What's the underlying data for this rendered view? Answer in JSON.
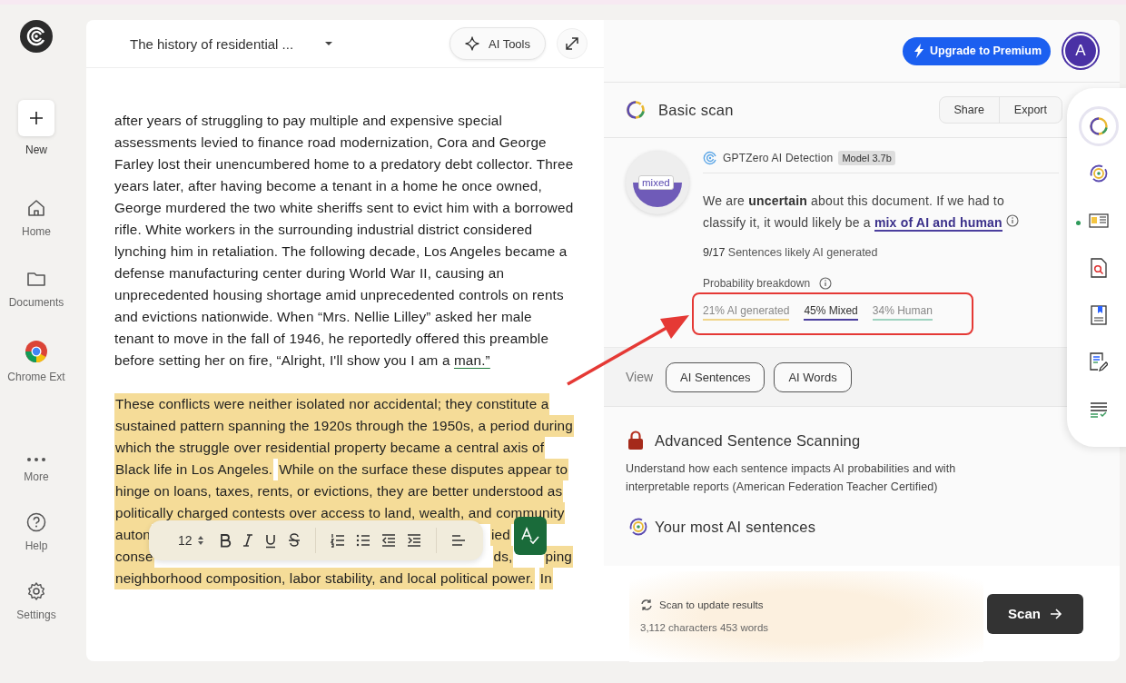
{
  "sidebar": {
    "top": [
      {
        "label": "New",
        "kind": "new"
      }
    ],
    "main": [
      {
        "label": "Home",
        "kind": "home"
      },
      {
        "label": "Documents",
        "kind": "folder"
      },
      {
        "label": "Chrome Ext",
        "kind": "chrome"
      }
    ],
    "bottom": [
      {
        "label": "More",
        "kind": "more"
      },
      {
        "label": "Help",
        "kind": "help"
      },
      {
        "label": "Settings",
        "kind": "settings"
      }
    ]
  },
  "editor": {
    "doc_title": "The history of residential ...",
    "ai_tools": "AI Tools",
    "paragraph_1": {
      "text": "after years of struggling to pay multiple and expensive special assessments levied to finance road modernization, Cora and George Farley lost their unencumbered home to a predatory debt collector. Three years later, after having become a tenant in a home he once owned, George murdered the two white sheriffs sent to evict him with a borrowed rifle. White workers in the surrounding industrial district considered lynching him in retaliation. The following decade, Los Angeles became a defense manufacturing center during World War II, causing an unprecedented housing shortage amid unprecedented controls on rents and evictions nationwide. When “Mrs. Nellie Lilley” asked her male tenant to move in the fall of 1946, he reportedly offered this preamble before setting her on fire, “Alright, I'll show you I am a",
      "flagged_word": "man.”"
    },
    "paragraph_2_lines": [
      {
        "kind": "full",
        "segments": [
          {
            "text": "These conflicts were neither isolated nor accidental; they constitute a",
            "highlighted": true
          }
        ]
      },
      {
        "kind": "full",
        "segments": [
          {
            "text": "sustained pattern spanning the 1920s through the 1950s, a period during",
            "highlighted": true
          }
        ]
      },
      {
        "kind": "full",
        "segments": [
          {
            "text": "which the struggle over residential property became a central axis of",
            "highlighted": true
          }
        ]
      },
      {
        "kind": "full",
        "segments": [
          {
            "text": "Black life in Los Angeles.",
            "highlighted": true
          },
          {
            "text": "While on the surface these disputes appear to",
            "highlighted": true
          }
        ]
      },
      {
        "kind": "full",
        "segments": [
          {
            "text": "hinge on loans, taxes, rents, or evictions, they are better understood as",
            "highlighted": true
          }
        ]
      },
      {
        "kind": "full",
        "segments": [
          {
            "text": "politically charged contests over access to land, wealth, and community",
            "highlighted": true
          }
        ]
      },
      {
        "kind": "covered",
        "segments": [
          {
            "text": "auton",
            "highlighted": true
          },
          {
            "text": "ied",
            "highlighted": true
          }
        ]
      },
      {
        "kind": "covered",
        "segments": [
          {
            "text": "conse",
            "highlighted": true
          },
          {
            "text": "ds,",
            "highlighted": true
          },
          {
            "text": "ping",
            "highlighted": true
          }
        ]
      },
      {
        "kind": "full",
        "segments": [
          {
            "text": "neighborhood composition, labor stability, and local political power.",
            "highlighted": true
          },
          {
            "text": "In",
            "highlighted": true
          }
        ]
      }
    ]
  },
  "format_toolbar": {
    "font_size": "12"
  },
  "header": {
    "upgrade": "Upgrade to Premium",
    "avatar": "A"
  },
  "scan": {
    "title": "Basic scan",
    "share": "Share",
    "export": "Export"
  },
  "result": {
    "gauge_label": "mixed",
    "detector": "GPTZero AI Detection",
    "model": "Model 3.7b",
    "verdict": "We are **uncertain** about this document. If we had to classify it, it would likely be a",
    "verdict_link": "mix of AI and human",
    "count": "9/17",
    "count_label": "Sentences likely AI generated",
    "breakdown_label": "Probability breakdown",
    "breakdown": [
      {
        "label": "21% AI generated",
        "color": "#f0d58a",
        "selected": false
      },
      {
        "label": "45% Mixed",
        "color": "#4b3f9e",
        "selected": true
      },
      {
        "label": "34% Human",
        "color": "#9fd3c0",
        "selected": false
      }
    ]
  },
  "view": {
    "label": "View",
    "buttons": [
      "AI Sentences",
      "AI Words"
    ]
  },
  "advanced": {
    "title": "Advanced Sentence Scanning",
    "text": "Understand how each sentence impacts AI probabilities and with interpretable reports (American Federation Teacher Certified)",
    "most_title": "Your most AI sentences"
  },
  "footer": {
    "status": "Scan to update results",
    "counts": "3,112 characters 453 words",
    "scan_button": "Scan"
  },
  "tools": [
    {
      "kind": "scan",
      "selected": true,
      "badge": false
    },
    {
      "kind": "target",
      "selected": false,
      "badge": false
    },
    {
      "kind": "card",
      "selected": false,
      "badge": true
    },
    {
      "kind": "search-doc",
      "selected": false,
      "badge": false
    },
    {
      "kind": "bookmark-doc",
      "selected": false,
      "badge": false
    },
    {
      "kind": "edit-doc",
      "selected": false,
      "badge": false
    },
    {
      "kind": "list-check",
      "selected": false,
      "badge": false
    }
  ]
}
